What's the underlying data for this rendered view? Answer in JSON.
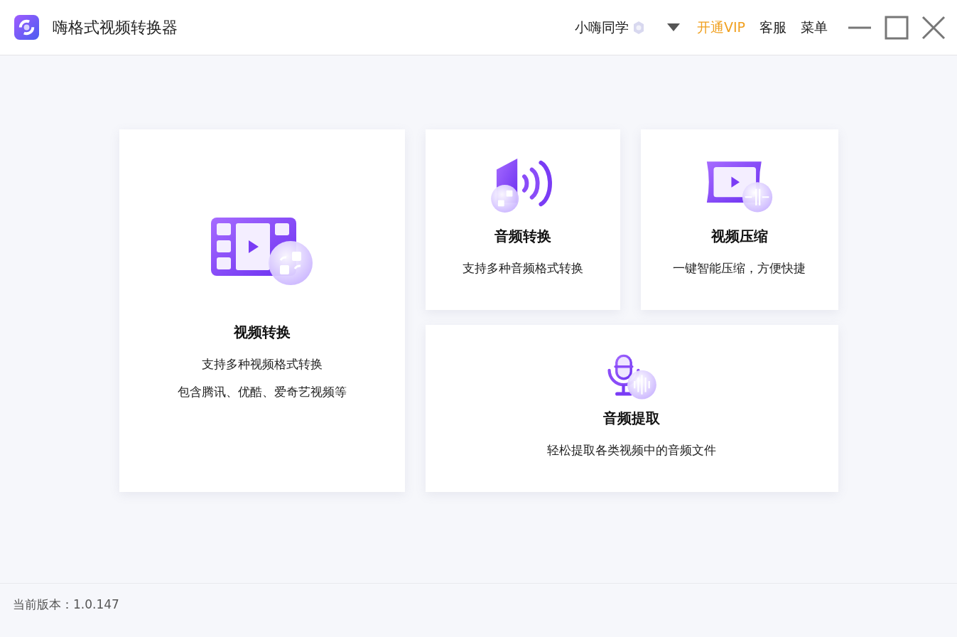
{
  "app": {
    "title": "嗨格式视频转换器"
  },
  "header": {
    "user_name": "小嗨同学",
    "vip_link": "开通VIP",
    "support_link": "客服",
    "menu_link": "菜单"
  },
  "cards": [
    {
      "kind": "video-convert",
      "title": "视频转换",
      "lines": [
        "支持多种视频格式转换",
        "包含腾讯、优酷、爱奇艺视频等"
      ]
    },
    {
      "kind": "audio-convert",
      "title": "音频转换",
      "lines": [
        "支持多种音频格式转换"
      ]
    },
    {
      "kind": "video-compress",
      "title": "视频压缩",
      "lines": [
        "一键智能压缩，方便快捷"
      ]
    },
    {
      "kind": "audio-extract",
      "title": "音频提取",
      "lines": [
        "轻松提取各类视频中的音频文件"
      ]
    }
  ],
  "footer": {
    "version": "当前版本：1.0.147"
  }
}
